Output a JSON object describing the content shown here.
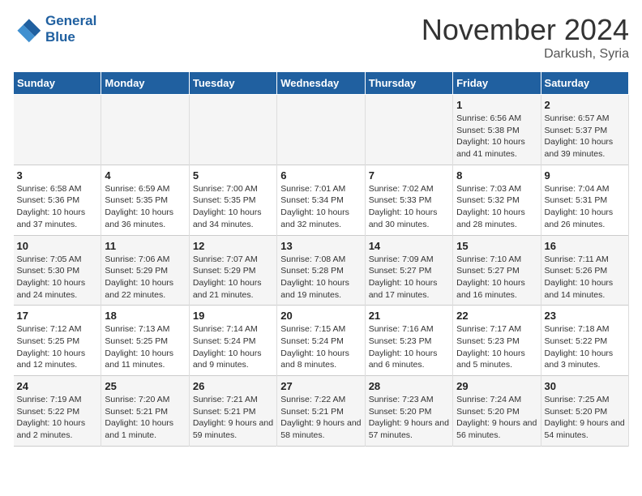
{
  "logo": {
    "line1": "General",
    "line2": "Blue"
  },
  "title": "November 2024",
  "location": "Darkush, Syria",
  "days_of_week": [
    "Sunday",
    "Monday",
    "Tuesday",
    "Wednesday",
    "Thursday",
    "Friday",
    "Saturday"
  ],
  "weeks": [
    [
      {
        "day": "",
        "content": ""
      },
      {
        "day": "",
        "content": ""
      },
      {
        "day": "",
        "content": ""
      },
      {
        "day": "",
        "content": ""
      },
      {
        "day": "",
        "content": ""
      },
      {
        "day": "1",
        "content": "Sunrise: 6:56 AM\nSunset: 5:38 PM\nDaylight: 10 hours and 41 minutes."
      },
      {
        "day": "2",
        "content": "Sunrise: 6:57 AM\nSunset: 5:37 PM\nDaylight: 10 hours and 39 minutes."
      }
    ],
    [
      {
        "day": "3",
        "content": "Sunrise: 6:58 AM\nSunset: 5:36 PM\nDaylight: 10 hours and 37 minutes."
      },
      {
        "day": "4",
        "content": "Sunrise: 6:59 AM\nSunset: 5:35 PM\nDaylight: 10 hours and 36 minutes."
      },
      {
        "day": "5",
        "content": "Sunrise: 7:00 AM\nSunset: 5:35 PM\nDaylight: 10 hours and 34 minutes."
      },
      {
        "day": "6",
        "content": "Sunrise: 7:01 AM\nSunset: 5:34 PM\nDaylight: 10 hours and 32 minutes."
      },
      {
        "day": "7",
        "content": "Sunrise: 7:02 AM\nSunset: 5:33 PM\nDaylight: 10 hours and 30 minutes."
      },
      {
        "day": "8",
        "content": "Sunrise: 7:03 AM\nSunset: 5:32 PM\nDaylight: 10 hours and 28 minutes."
      },
      {
        "day": "9",
        "content": "Sunrise: 7:04 AM\nSunset: 5:31 PM\nDaylight: 10 hours and 26 minutes."
      }
    ],
    [
      {
        "day": "10",
        "content": "Sunrise: 7:05 AM\nSunset: 5:30 PM\nDaylight: 10 hours and 24 minutes."
      },
      {
        "day": "11",
        "content": "Sunrise: 7:06 AM\nSunset: 5:29 PM\nDaylight: 10 hours and 22 minutes."
      },
      {
        "day": "12",
        "content": "Sunrise: 7:07 AM\nSunset: 5:29 PM\nDaylight: 10 hours and 21 minutes."
      },
      {
        "day": "13",
        "content": "Sunrise: 7:08 AM\nSunset: 5:28 PM\nDaylight: 10 hours and 19 minutes."
      },
      {
        "day": "14",
        "content": "Sunrise: 7:09 AM\nSunset: 5:27 PM\nDaylight: 10 hours and 17 minutes."
      },
      {
        "day": "15",
        "content": "Sunrise: 7:10 AM\nSunset: 5:27 PM\nDaylight: 10 hours and 16 minutes."
      },
      {
        "day": "16",
        "content": "Sunrise: 7:11 AM\nSunset: 5:26 PM\nDaylight: 10 hours and 14 minutes."
      }
    ],
    [
      {
        "day": "17",
        "content": "Sunrise: 7:12 AM\nSunset: 5:25 PM\nDaylight: 10 hours and 12 minutes."
      },
      {
        "day": "18",
        "content": "Sunrise: 7:13 AM\nSunset: 5:25 PM\nDaylight: 10 hours and 11 minutes."
      },
      {
        "day": "19",
        "content": "Sunrise: 7:14 AM\nSunset: 5:24 PM\nDaylight: 10 hours and 9 minutes."
      },
      {
        "day": "20",
        "content": "Sunrise: 7:15 AM\nSunset: 5:24 PM\nDaylight: 10 hours and 8 minutes."
      },
      {
        "day": "21",
        "content": "Sunrise: 7:16 AM\nSunset: 5:23 PM\nDaylight: 10 hours and 6 minutes."
      },
      {
        "day": "22",
        "content": "Sunrise: 7:17 AM\nSunset: 5:23 PM\nDaylight: 10 hours and 5 minutes."
      },
      {
        "day": "23",
        "content": "Sunrise: 7:18 AM\nSunset: 5:22 PM\nDaylight: 10 hours and 3 minutes."
      }
    ],
    [
      {
        "day": "24",
        "content": "Sunrise: 7:19 AM\nSunset: 5:22 PM\nDaylight: 10 hours and 2 minutes."
      },
      {
        "day": "25",
        "content": "Sunrise: 7:20 AM\nSunset: 5:21 PM\nDaylight: 10 hours and 1 minute."
      },
      {
        "day": "26",
        "content": "Sunrise: 7:21 AM\nSunset: 5:21 PM\nDaylight: 9 hours and 59 minutes."
      },
      {
        "day": "27",
        "content": "Sunrise: 7:22 AM\nSunset: 5:21 PM\nDaylight: 9 hours and 58 minutes."
      },
      {
        "day": "28",
        "content": "Sunrise: 7:23 AM\nSunset: 5:20 PM\nDaylight: 9 hours and 57 minutes."
      },
      {
        "day": "29",
        "content": "Sunrise: 7:24 AM\nSunset: 5:20 PM\nDaylight: 9 hours and 56 minutes."
      },
      {
        "day": "30",
        "content": "Sunrise: 7:25 AM\nSunset: 5:20 PM\nDaylight: 9 hours and 54 minutes."
      }
    ]
  ]
}
